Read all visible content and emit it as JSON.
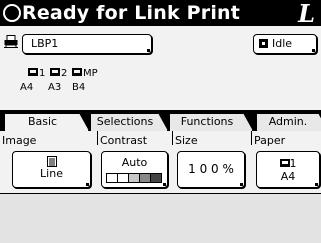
{
  "header": {
    "title": "Ready for Link Print",
    "logo": "L"
  },
  "printer": {
    "name": "LBP1",
    "status": "Idle"
  },
  "trays": [
    {
      "number": "1",
      "size": "A4"
    },
    {
      "number": "2",
      "size": "A3"
    },
    {
      "number": "MP",
      "size": "B4"
    }
  ],
  "tabs": [
    {
      "label": "Basic",
      "active": true
    },
    {
      "label": "Selections",
      "active": false
    },
    {
      "label": "Functions",
      "active": false
    },
    {
      "label": "Admin.",
      "active": false
    }
  ],
  "settings": {
    "image": {
      "label": "Image",
      "value": "Line"
    },
    "contrast": {
      "label": "Contrast",
      "value": "Auto",
      "level": 2,
      "levels": 5
    },
    "size": {
      "label": "Size",
      "value": "1 0 0 %"
    },
    "paper": {
      "label": "Paper",
      "tray": "1",
      "value": "A4"
    }
  }
}
